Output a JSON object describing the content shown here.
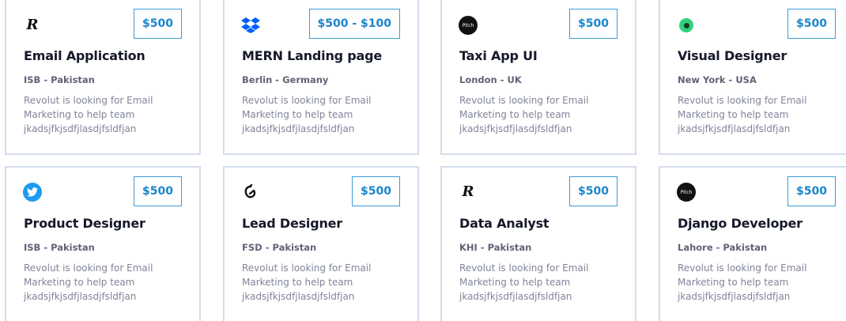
{
  "colors": {
    "card_border": "#d4dced",
    "price_border": "#3b9bd8",
    "price_text": "#1a86cc",
    "title": "#15192b",
    "location": "#5f6377",
    "description": "#80849a",
    "twitter_blue": "#1d9bf0",
    "dropbox_blue": "#0061fe",
    "green_logo": "#2fd37a"
  },
  "cards": [
    {
      "logo_icon": "revolut-icon",
      "logo_text": "R",
      "price": "$500",
      "title": "Email Application",
      "location": "ISB - Pakistan",
      "description": [
        "Revolut is looking for Email",
        "Marketing to help team",
        "jkadsjfkjsdfjlasdjfsldfjan"
      ]
    },
    {
      "logo_icon": "dropbox-icon",
      "price": "$500 - $100",
      "title": "MERN Landing page",
      "location": "Berlin - Germany",
      "description": [
        "Revolut is looking for Email",
        "Marketing to help team",
        "jkadsjfkjsdfjlasdjfsldfjan"
      ]
    },
    {
      "logo_icon": "pitch-icon",
      "logo_text": "Pitch",
      "price": "$500",
      "title": "Taxi App UI",
      "location": "London - UK",
      "description": [
        "Revolut is looking for Email",
        "Marketing to help team",
        "jkadsjfkjsdfjlasdjfsldfjan"
      ]
    },
    {
      "logo_icon": "green-circle-icon",
      "price": "$500",
      "title": "Visual Designer",
      "location": "New York - USA",
      "description": [
        "Revolut is looking for Email",
        "Marketing to help team",
        "jkadsjfkjsdfjlasdjfsldfjan"
      ]
    },
    {
      "logo_icon": "twitter-icon",
      "price": "$500",
      "title": "Product Designer",
      "location": "ISB - Pakistan",
      "description": [
        "Revolut is looking for Email",
        "Marketing to help team",
        "jkadsjfkjsdfjlasdjfsldfjan"
      ]
    },
    {
      "logo_icon": "glassdoor-icon",
      "price": "$500",
      "title": "Lead Designer",
      "location": "FSD - Pakistan",
      "description": [
        "Revolut is looking for Email",
        "Marketing to help team",
        "jkadsjfkjsdfjlasdjfsldfjan"
      ]
    },
    {
      "logo_icon": "revolut-icon",
      "logo_text": "R",
      "price": "$500",
      "title": "Data Analyst",
      "location": "KHI - Pakistan",
      "description": [
        "Revolut is looking for Email",
        "Marketing to help team",
        "jkadsjfkjsdfjlasdjfsldfjan"
      ]
    },
    {
      "logo_icon": "pitch-icon",
      "logo_text": "Pitch",
      "price": "$500",
      "title": "Django Developer",
      "location": "Lahore - Pakistan",
      "description": [
        "Revolut is looking for Email",
        "Marketing to help team",
        "jkadsjfkjsdfjlasdjfsldfjan"
      ]
    }
  ]
}
